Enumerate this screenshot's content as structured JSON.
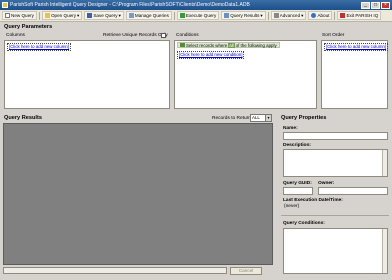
{
  "window": {
    "title": "ParishSoft Parish Intelligent Query Designer - C:\\Program Files\\ParishSOFT\\Clients\\Demo\\DemoData1.ADB"
  },
  "toolbar": {
    "items": [
      {
        "label": "New Query",
        "icon": "new-document-icon"
      },
      {
        "label": "Open Query",
        "icon": "folder-icon",
        "dropdown": "▾"
      },
      {
        "label": "Save Query",
        "icon": "save-icon",
        "dropdown": "▾"
      },
      {
        "label": "Manage Queries",
        "icon": "list-icon"
      },
      {
        "label": "Execute Query",
        "icon": "execute-icon"
      },
      {
        "label": "Query Results",
        "icon": "results-icon",
        "dropdown": "▾"
      },
      {
        "label": "Advanced",
        "icon": "advanced-icon",
        "dropdown": "▾"
      },
      {
        "label": "About",
        "icon": "info-icon"
      },
      {
        "label": "Exit PARISH IQ",
        "icon": "exit-icon"
      }
    ]
  },
  "query_parameters": {
    "title": "Query Parameters",
    "columns": {
      "header": "Columns",
      "retrieve_unique_label": "Retrieve Unique Records Only",
      "add_link": "[Click here to add new column]"
    },
    "conditions": {
      "header": "Conditions",
      "select_records_text": "Select records where",
      "all_text": "all",
      "following_text": "of the following apply",
      "add_link": "[Click here to add new condition]"
    },
    "sort_order": {
      "header": "Sort Order",
      "add_link": "[Click here to add new column]"
    }
  },
  "query_results": {
    "title": "Query Results",
    "records_label": "Records to Return:",
    "records_value": "ALL",
    "cancel_label": "Cancel"
  },
  "query_properties": {
    "title": "Query Properties",
    "name_label": "Name:",
    "description_label": "Description:",
    "guid_label": "Query GUID:",
    "owner_label": "Owner:",
    "last_exec_label": "Last Execution Date/Time:",
    "last_exec_value": "(never)",
    "conditions_label": "Query Conditions:"
  },
  "colors": {
    "titlebar": "#1d4f8a",
    "results_bg": "#808080",
    "link": "#0000cc",
    "cursor": "#cc1111"
  }
}
